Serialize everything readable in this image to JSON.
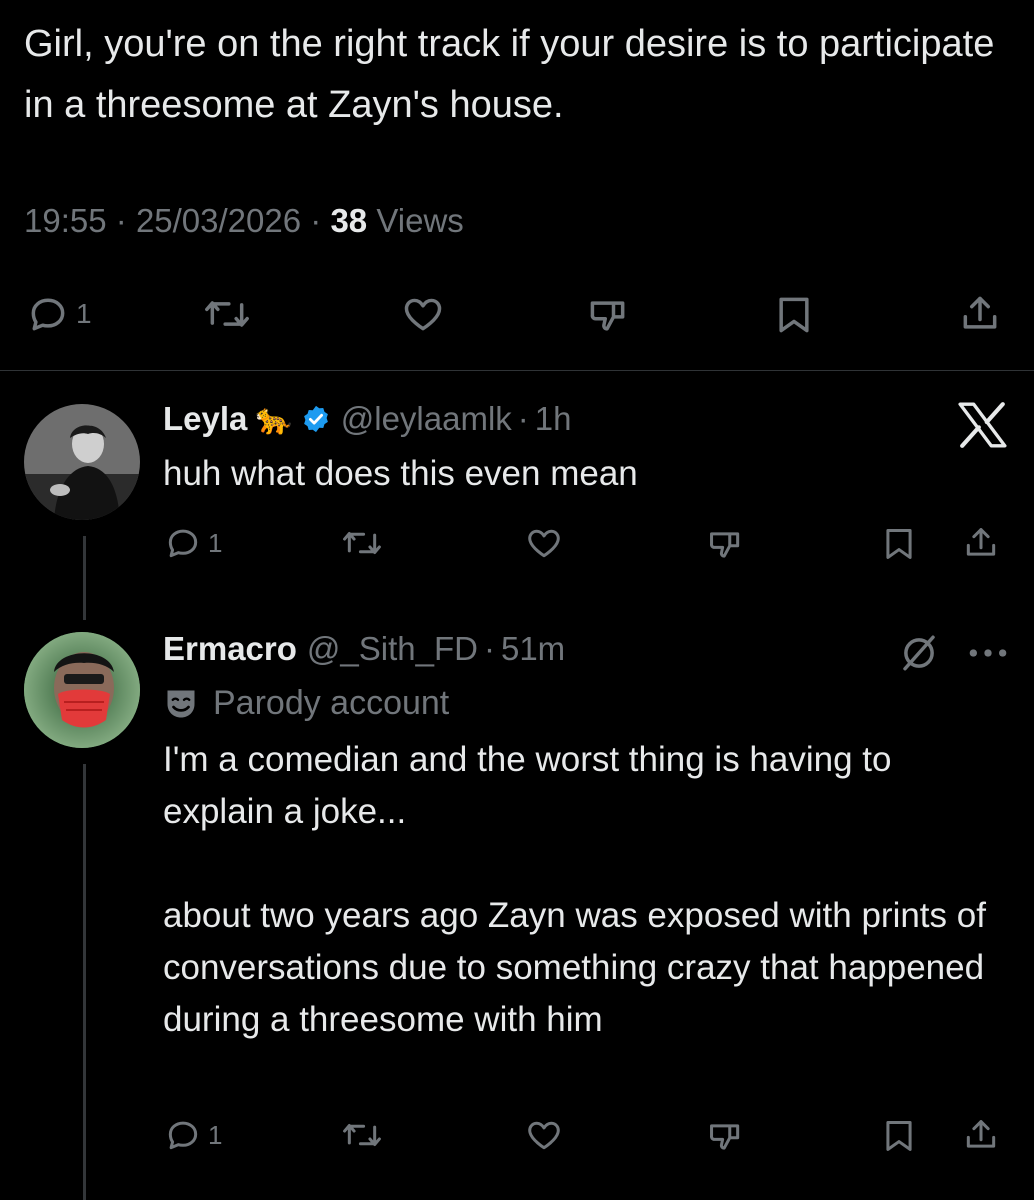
{
  "main_tweet": {
    "text": "Girl, you're on the right track if your desire is to participate in a threesome at Zayn's house.",
    "time": "19:55",
    "date": "25/03/2026",
    "separator": "·",
    "views_count": "38",
    "views_label": "Views",
    "actions": {
      "reply_count": "1"
    }
  },
  "replies": [
    {
      "name": "Leyla",
      "emoji": "🐆",
      "verified": true,
      "handle": "@leylaamlk",
      "separator": "·",
      "time": "1h",
      "text": "huh what does this even mean",
      "reply_count": "1"
    },
    {
      "name": "Ermacro",
      "handle": "@_Sith_FD",
      "separator": "·",
      "time": "51m",
      "label": "Parody account",
      "text": "I'm a comedian and the worst thing is having to explain a joke...\n\nabout two years ago Zayn was exposed with prints of conversations due to something crazy that happened during a threesome with him",
      "reply_count": "1"
    }
  ],
  "icons": {
    "reply": "reply-icon",
    "retweet": "retweet-icon",
    "like": "heart-icon",
    "dislike": "dislike-icon",
    "bookmark": "bookmark-icon",
    "share": "share-icon",
    "verified": "verified-badge-icon",
    "x_logo": "x-logo-icon",
    "grok": "grok-icon",
    "more": "more-icon",
    "parody": "parody-mask-icon"
  },
  "colors": {
    "background": "#000000",
    "text": "#e7e9ea",
    "muted": "#71767b",
    "verified": "#1d9bf0",
    "divider": "#2f3336"
  }
}
